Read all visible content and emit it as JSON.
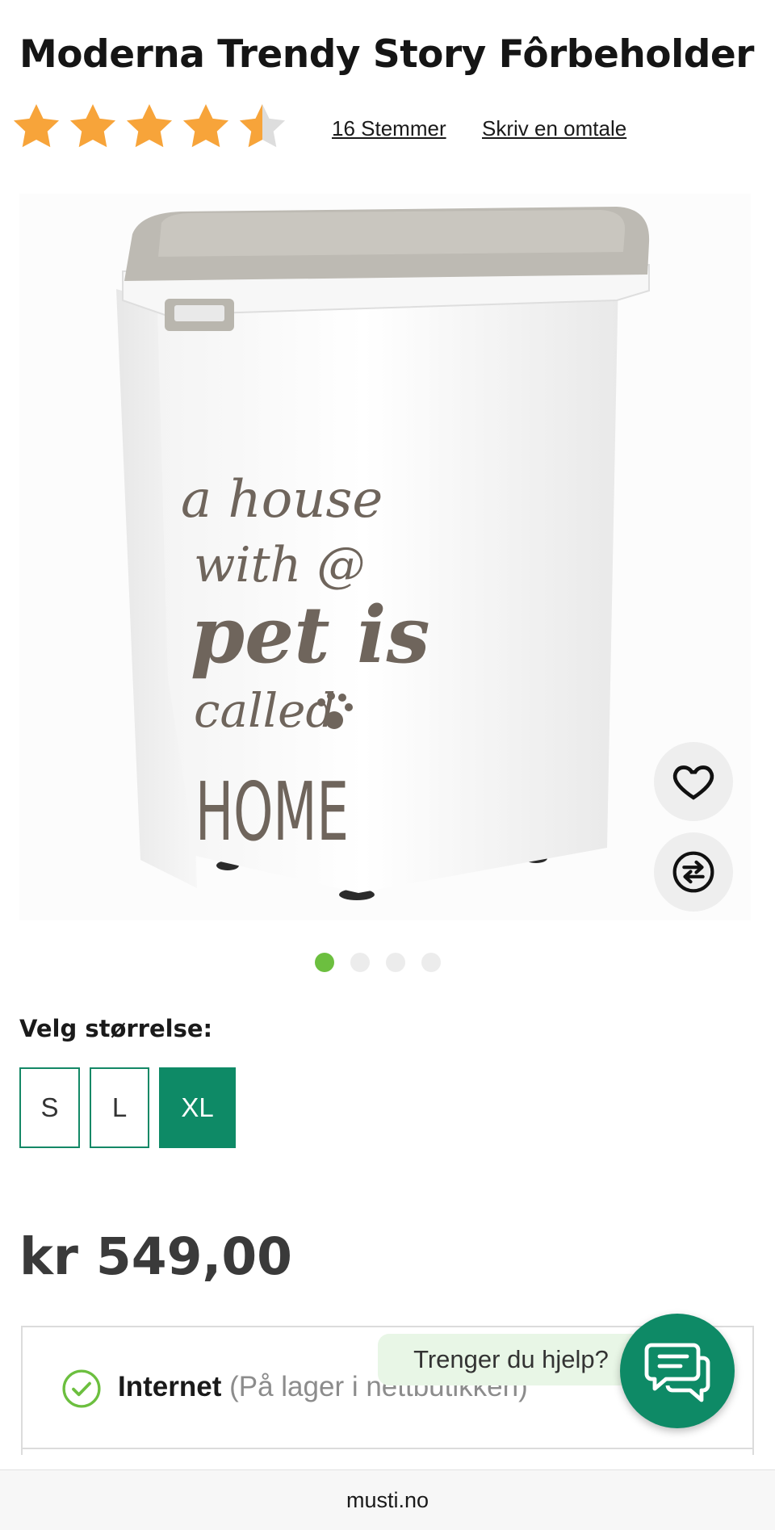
{
  "product": {
    "title": "Moderna Trendy Story Fôrbeholder",
    "rating": 4.5,
    "rating_max": 5,
    "votes_label": "16 Stemmer",
    "review_link": "Skriv en omtale",
    "image_text": [
      "a house",
      "with @",
      "pet is",
      "called",
      "HOME"
    ],
    "image_count": 4,
    "image_active": 1
  },
  "sizes": {
    "label": "Velg størrelse:",
    "options": [
      "S",
      "L",
      "XL"
    ],
    "selected": "XL"
  },
  "price": "kr 549,00",
  "stock": {
    "channel": "Internet",
    "detail": "(På lager i nettbutikken)"
  },
  "chat": {
    "help_label": "Trenger du hjelp?"
  },
  "browser": {
    "url": "musti.no"
  },
  "colors": {
    "star": "#f7a43a",
    "star_empty": "#dddddd",
    "accent_green": "#0e8a66",
    "dot_active": "#6cbf3f",
    "check": "#6cbf3f",
    "help_bg": "#e8f6e6"
  },
  "icons": {
    "favorite": "heart-icon",
    "compare": "compare-arrows-icon",
    "chat": "chat-bubbles-icon",
    "stock": "check-circle-icon"
  }
}
